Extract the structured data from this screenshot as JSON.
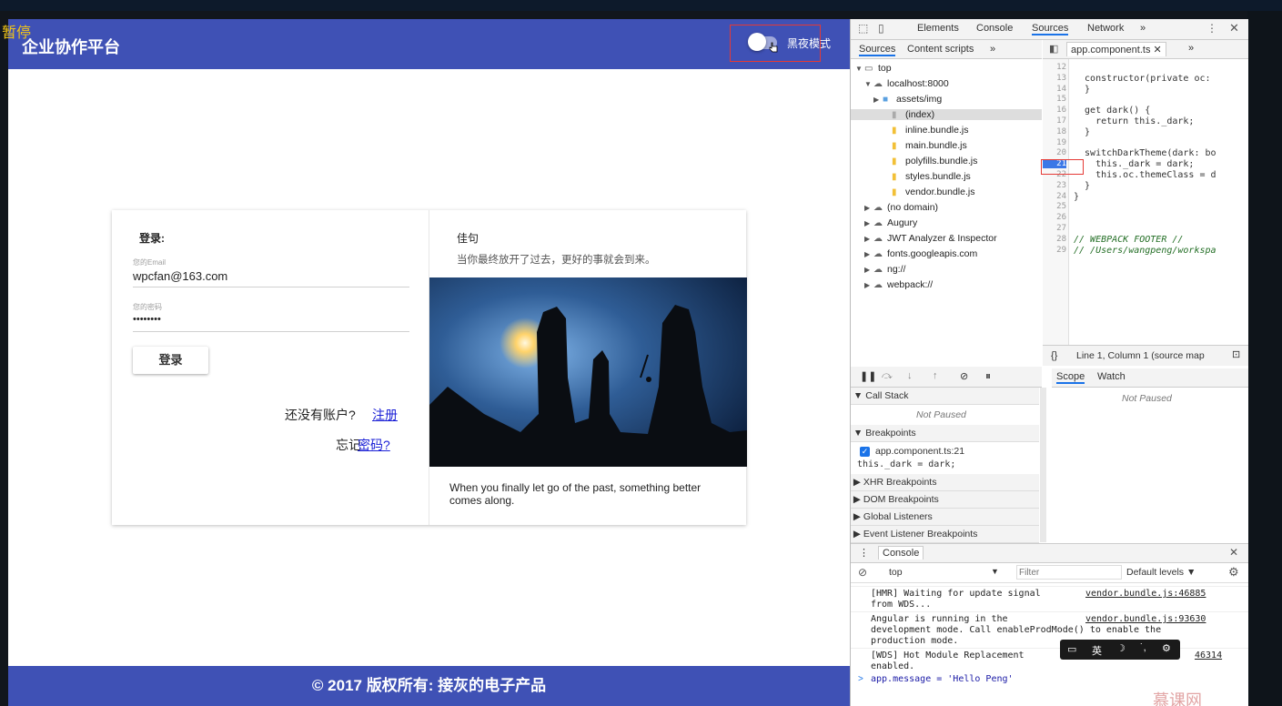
{
  "overlay": {
    "paused": "暂停"
  },
  "app": {
    "title": "企业协作平台",
    "dark_mode_label": "黑夜模式",
    "login": {
      "heading": "登录:",
      "email_label": "您的Email",
      "email_value": "wpcfan@163.com",
      "password_label": "您的密码",
      "password_value": "••••••••",
      "login_button": "登录",
      "no_account_text": "还没有账户?",
      "register_link": "注册",
      "forgot_text": "忘记",
      "password_link": "密码?"
    },
    "quote": {
      "heading": "佳句",
      "text_cn": "当你最终放开了过去，更好的事就会到来。",
      "text_en": "When you finally let go of the past, something better comes along."
    },
    "footer": "© 2017 版权所有: 接灰的电子产品"
  },
  "devtools": {
    "top_tabs": [
      "Elements",
      "Console",
      "Sources",
      "Network",
      "»"
    ],
    "active_tab": "Sources",
    "nav_tabs": [
      "Sources",
      "Content scripts",
      "»"
    ],
    "file_tab": "app.component.ts",
    "tree": [
      {
        "label": "top",
        "kind": "frame",
        "arrow": "▼"
      },
      {
        "label": "localhost:8000",
        "kind": "cloud",
        "arrow": "▼"
      },
      {
        "label": "assets/img",
        "kind": "folder",
        "arrow": "▶"
      },
      {
        "label": "(index)",
        "kind": "file",
        "arrow": ""
      },
      {
        "label": "inline.bundle.js",
        "kind": "file",
        "arrow": ""
      },
      {
        "label": "main.bundle.js",
        "kind": "file",
        "arrow": ""
      },
      {
        "label": "polyfills.bundle.js",
        "kind": "file",
        "arrow": ""
      },
      {
        "label": "styles.bundle.js",
        "kind": "file",
        "arrow": ""
      },
      {
        "label": "vendor.bundle.js",
        "kind": "file",
        "arrow": ""
      },
      {
        "label": "(no domain)",
        "kind": "cloud",
        "arrow": "▶"
      },
      {
        "label": "Augury",
        "kind": "cloud",
        "arrow": "▶"
      },
      {
        "label": "JWT Analyzer & Inspector",
        "kind": "cloud",
        "arrow": "▶"
      },
      {
        "label": "fonts.googleapis.com",
        "kind": "cloud",
        "arrow": "▶"
      },
      {
        "label": "ng://",
        "kind": "cloud",
        "arrow": "▶"
      },
      {
        "label": "webpack://",
        "kind": "cloud",
        "arrow": "▶"
      }
    ],
    "code_lines": [
      {
        "n": "12",
        "text": ""
      },
      {
        "n": "13",
        "text": "  constructor(private oc:"
      },
      {
        "n": "14",
        "text": "  }"
      },
      {
        "n": "15",
        "text": ""
      },
      {
        "n": "16",
        "text": "  get dark() {"
      },
      {
        "n": "17",
        "text": "    return this._dark;"
      },
      {
        "n": "18",
        "text": "  }"
      },
      {
        "n": "19",
        "text": ""
      },
      {
        "n": "20",
        "text": "  switchDarkTheme(dark: bo"
      },
      {
        "n": "21",
        "text": "    this._dark = dark;"
      },
      {
        "n": "22",
        "text": "    this.oc.themeClass = d"
      },
      {
        "n": "23",
        "text": "  }"
      },
      {
        "n": "24",
        "text": "}"
      },
      {
        "n": "25",
        "text": ""
      },
      {
        "n": "26",
        "text": ""
      },
      {
        "n": "27",
        "text": ""
      },
      {
        "n": "28",
        "text": "// WEBPACK FOOTER //"
      },
      {
        "n": "29",
        "text": "// /Users/wangpeng/workspa"
      }
    ],
    "status_bar": "Line 1, Column 1  (source map",
    "debug_tabs": [
      "Scope",
      "Watch"
    ],
    "not_paused": "Not Paused",
    "call_stack": "Call Stack",
    "breakpoints": "Breakpoints",
    "breakpoint_file": "app.component.ts:21",
    "breakpoint_code": "this._dark = dark;",
    "xhr": "XHR Breakpoints",
    "dom": "DOM Breakpoints",
    "global": "Global Listeners",
    "event": "Event Listener Breakpoints",
    "console_title": "Console",
    "console_context": "top",
    "console_filter_placeholder": "Filter",
    "console_levels": "Default levels ▼",
    "console_messages": [
      {
        "text": "[HMR] Waiting for update signal\nfrom WDS...",
        "src": "vendor.bundle.js:46885"
      },
      {
        "text": "Angular is running in the\ndevelopment mode. Call enableProdMode() to enable the\nproduction mode.",
        "src": "vendor.bundle.js:93630"
      },
      {
        "text": "[WDS] Hot Module Replacement\nenabled.",
        "src": "46314"
      }
    ],
    "console_input": "app.message = 'Hello Peng'",
    "ime_label": "英",
    "watermark": "慕课网"
  }
}
